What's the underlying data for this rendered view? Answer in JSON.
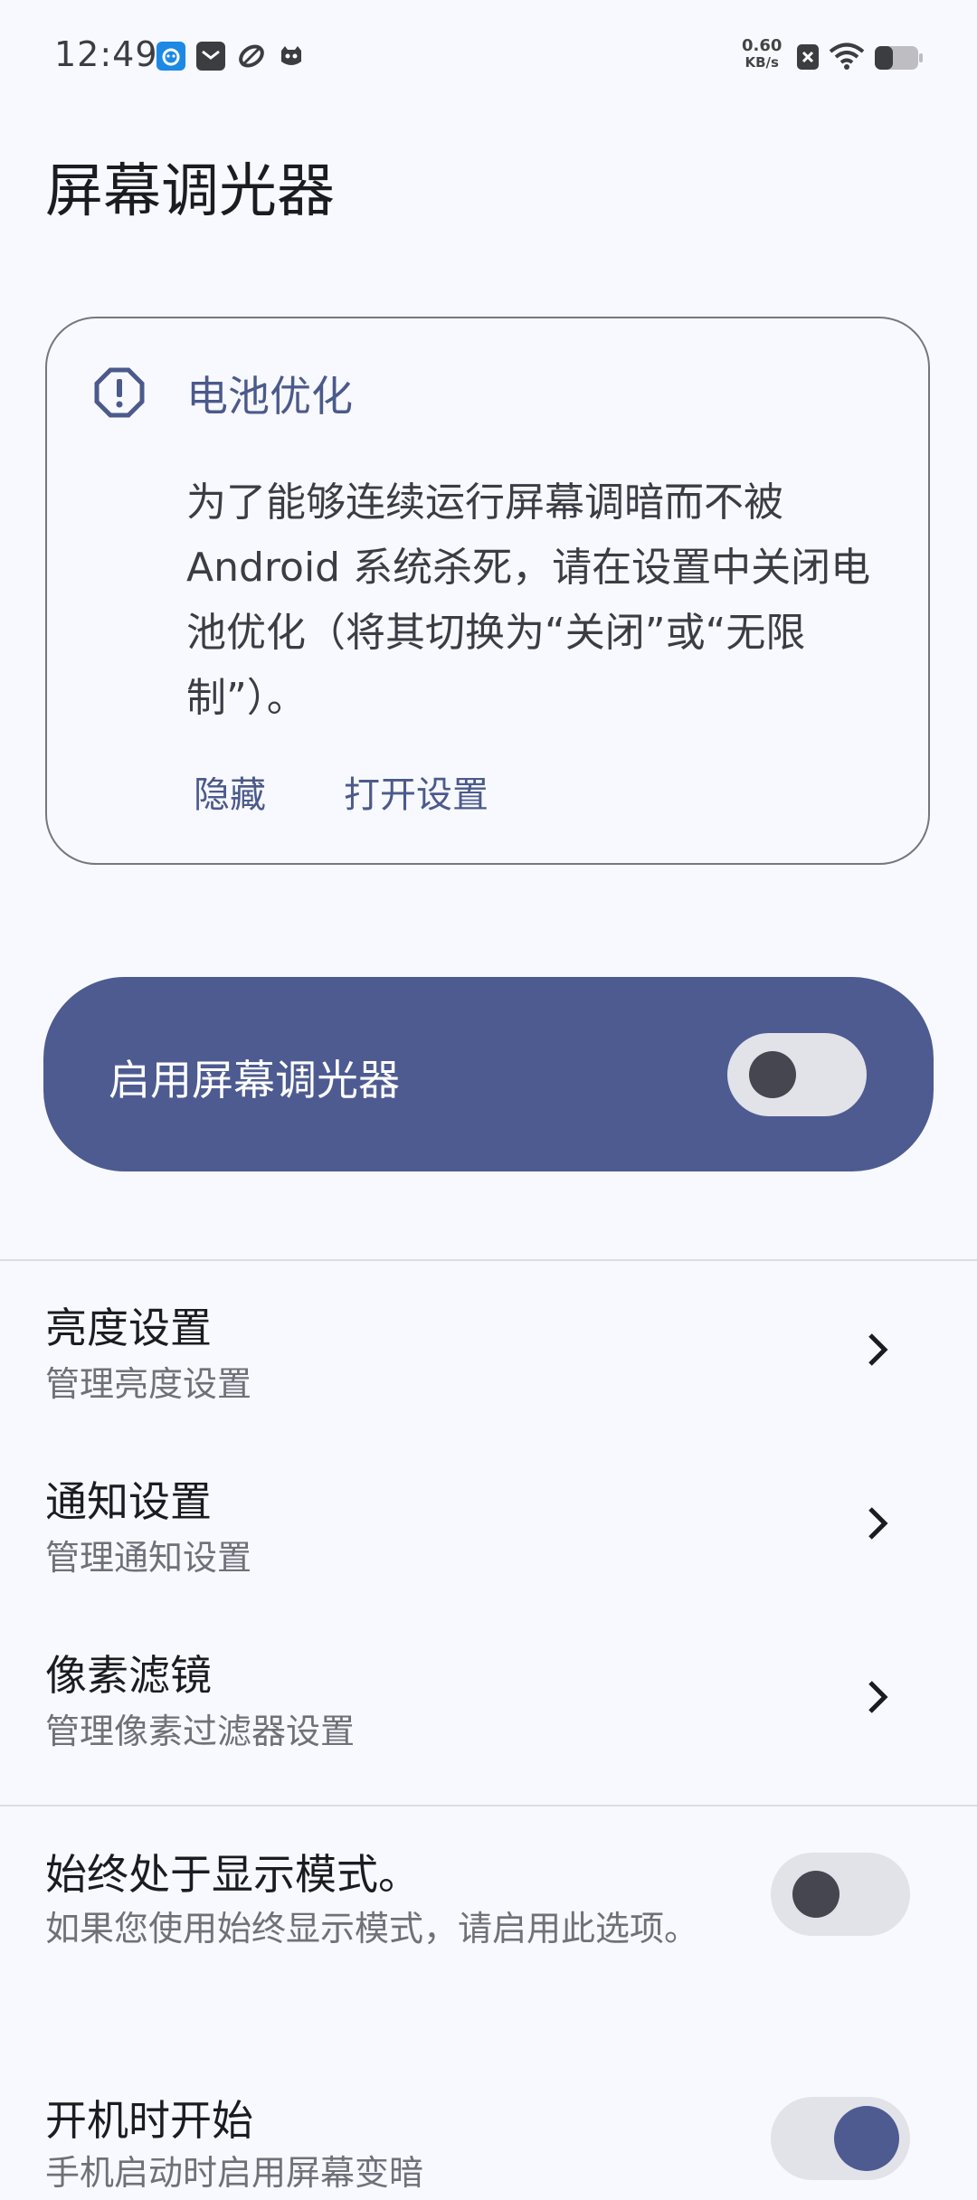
{
  "status_bar": {
    "time": "12:49",
    "net_speed_value": "0.60",
    "net_speed_unit": "KB/s",
    "icons": [
      "app-notification-icon",
      "mail-icon",
      "sync-icon",
      "cat-icon",
      "close-box-icon",
      "wifi-icon",
      "battery-icon"
    ]
  },
  "page": {
    "title": "屏幕调光器"
  },
  "battery_card": {
    "title": "电池优化",
    "body": "为了能够连续运行屏幕调暗而不被 Android 系统杀死，请在设置中关闭电池优化（将其切换为“关闭”或“无限制”）。",
    "hide_label": "隐藏",
    "open_settings_label": "打开设置"
  },
  "main_switch": {
    "label": "启用屏幕调光器",
    "on": false
  },
  "settings": [
    {
      "title": "亮度设置",
      "subtitle": "管理亮度设置"
    },
    {
      "title": "通知设置",
      "subtitle": "管理通知设置"
    },
    {
      "title": "像素滤镜",
      "subtitle": "管理像素过滤器设置"
    }
  ],
  "aod": {
    "title": "始终处于显示模式。",
    "subtitle": "如果您使用始终显示模式，请启用此选项。",
    "on": false
  },
  "boot": {
    "title": "开机时开始",
    "subtitle": "手机启动时启用屏幕变暗",
    "on": true
  },
  "colors": {
    "accent": "#4d5b91",
    "accent_text": "#4b5a8b",
    "background": "#f8f9fe",
    "toggle_track": "#e2e2e9"
  }
}
